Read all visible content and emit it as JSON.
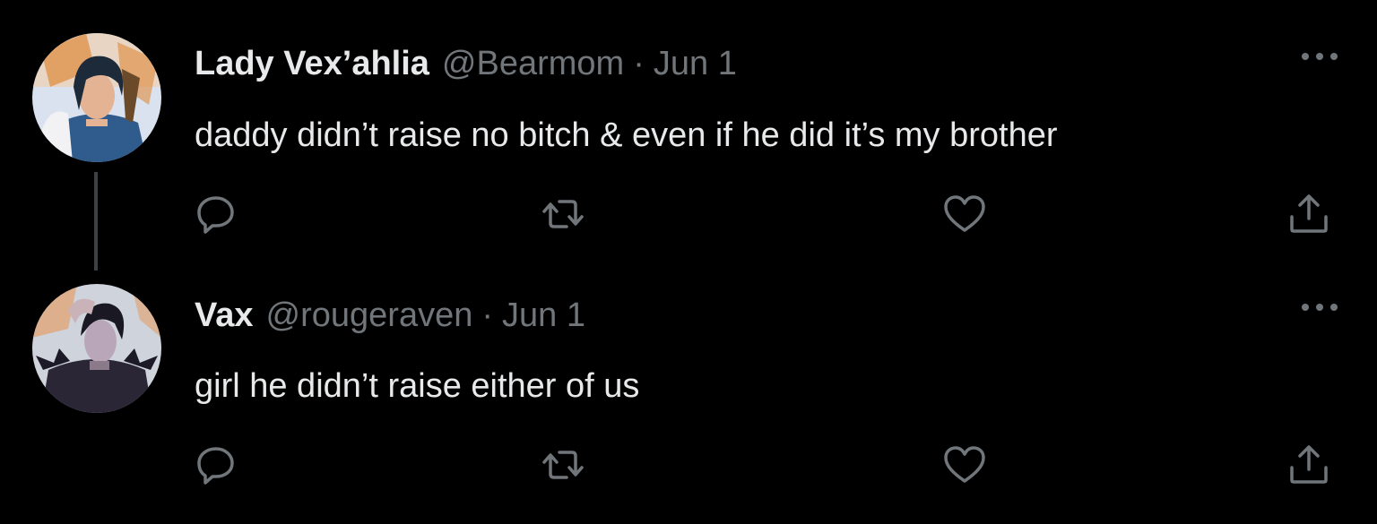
{
  "colors": {
    "background": "#000000",
    "primary_text": "#e7e9ea",
    "secondary_text": "#71767b",
    "thread_line": "#3e4144"
  },
  "tweets": [
    {
      "display_name": "Lady Vex’ahlia",
      "handle": "@Bearmom",
      "separator": "·",
      "date": "Jun 1",
      "text": "daddy didn’t raise no bitch & even if he did it’s my brother",
      "avatar": "avatar-illustrated-woman",
      "actions": [
        "reply-icon",
        "retweet-icon",
        "like-icon",
        "share-icon"
      ]
    },
    {
      "display_name": "Vax",
      "handle": "@rougeraven",
      "separator": "·",
      "date": "Jun 1",
      "text": "girl he didn’t raise either of us",
      "avatar": "avatar-illustrated-man",
      "actions": [
        "reply-icon",
        "retweet-icon",
        "like-icon",
        "share-icon"
      ]
    }
  ]
}
